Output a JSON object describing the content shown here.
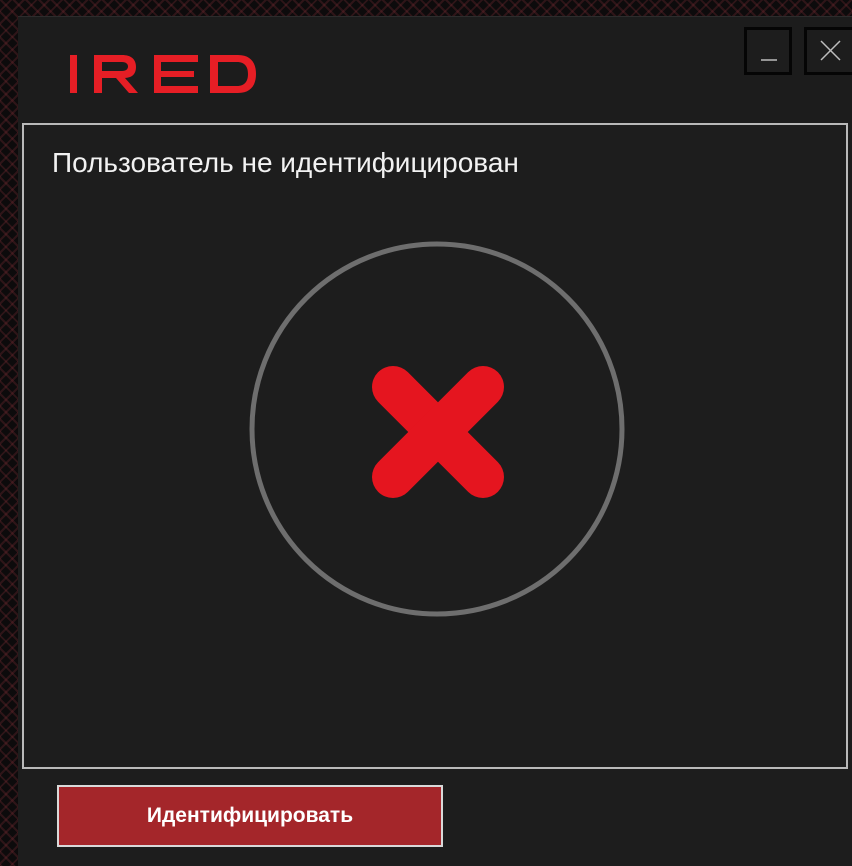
{
  "app": {
    "brand": "IRED",
    "brand_color": "#e61e25"
  },
  "window_controls": {
    "minimize_icon": "minimize-icon",
    "close_icon": "close-icon"
  },
  "status": {
    "message": "Пользователь не идентифицирован",
    "state_icon": "x-mark-icon",
    "icon_color": "#e5151f",
    "ring_color": "#6e6e6e"
  },
  "footer": {
    "identify_label": "Идентифицировать",
    "button_color": "#a4262a"
  }
}
